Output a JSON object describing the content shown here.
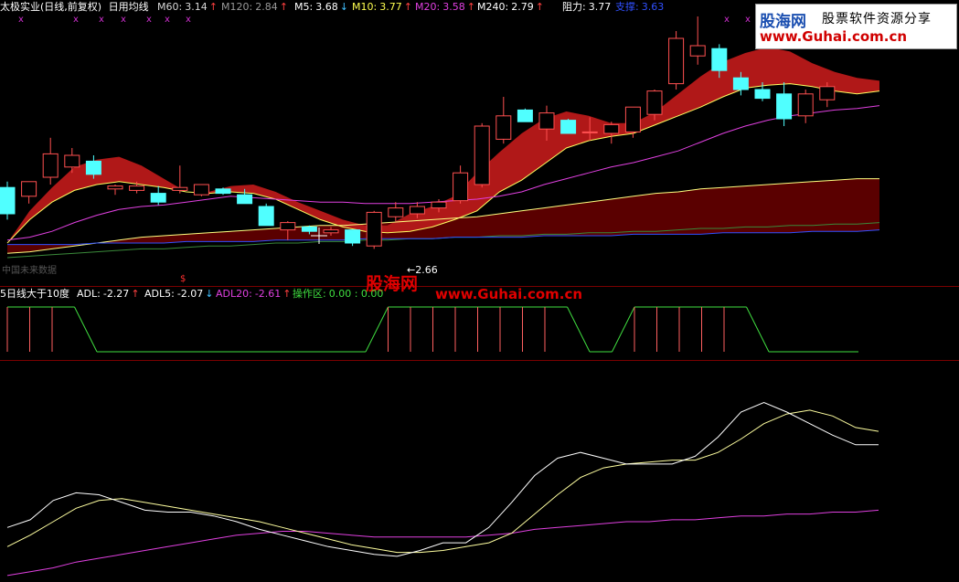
{
  "header": {
    "title": "太极实业(日线,前复权)",
    "indicator": "日用均线",
    "legend": [
      {
        "label": "M60:",
        "value": "3.14",
        "arrow": "↑",
        "color": "#d8d8d8",
        "x": 172
      },
      {
        "label": "M120:",
        "value": "2.84",
        "arrow": "↑",
        "color": "#9a9a9a",
        "x": 242
      },
      {
        "label": "M5:",
        "value": "3.68",
        "arrow": "↓",
        "color": "#ffffff",
        "x": 322
      },
      {
        "label": "M10:",
        "value": "3.77",
        "arrow": "↑",
        "color": "#ffff50",
        "x": 385
      },
      {
        "label": "M20:",
        "value": "3.58",
        "arrow": "↑",
        "color": "#e040e0",
        "x": 454
      },
      {
        "label": "M240:",
        "value": "2.79",
        "arrow": "↑",
        "color": "#ffffff",
        "x": 522
      },
      {
        "label": "阻力:",
        "value": "3.77",
        "arrow": "",
        "color": "#ffffff",
        "x": 615
      },
      {
        "label": "支撑:",
        "value": "3.63",
        "arrow": "",
        "color": "#3050ff",
        "x": 673
      }
    ]
  },
  "price_panel": {
    "low_marker": "←2.66",
    "bottom_note": "中国未来数据",
    "dollar_sign": "$",
    "watermark_text": "股海网",
    "watermark_url": "www.Guhai.com.cn"
  },
  "adl_panel": {
    "legend": [
      {
        "label": "5日线大于10度",
        "value": "",
        "arrow": "",
        "color": "#ffffff",
        "x": 0
      },
      {
        "label": "ADL:",
        "value": "-2.27",
        "arrow": "↑",
        "color": "#ffffff",
        "x": 84
      },
      {
        "label": "ADL5:",
        "value": "-2.07",
        "arrow": "↓",
        "color": "#ffffff",
        "x": 158
      },
      {
        "label": "ADL20:",
        "value": "-2.61",
        "arrow": "↑",
        "color": "#e040e0",
        "x": 236
      },
      {
        "label": "操作区:",
        "value": "0.00 : 0.00",
        "arrow": "",
        "color": "#40e040",
        "x": 320
      }
    ]
  },
  "logo": {
    "brand": "股海网",
    "slogan": "股票软件资源分享",
    "url": "www.Guhai.com.cn"
  },
  "colors": {
    "up": "#ff5050",
    "down": "#50ffff",
    "band": "#b01818",
    "band_dark": "#5a0000",
    "m60": "#ffff80",
    "m20": "#e040e0",
    "support": "#3050ff",
    "zone_line": "#40e040"
  },
  "chart_data": {
    "type": "candlestick",
    "ylim": [
      2.55,
      4.25
    ],
    "candles": [
      {
        "o": 3.08,
        "h": 3.12,
        "l": 2.86,
        "c": 2.9
      },
      {
        "o": 3.02,
        "h": 3.06,
        "l": 2.97,
        "c": 3.12
      },
      {
        "o": 3.15,
        "h": 3.42,
        "l": 3.1,
        "c": 3.31
      },
      {
        "o": 3.22,
        "h": 3.35,
        "l": 3.18,
        "c": 3.3
      },
      {
        "o": 3.26,
        "h": 3.3,
        "l": 3.14,
        "c": 3.17
      },
      {
        "o": 3.07,
        "h": 3.1,
        "l": 3.03,
        "c": 3.09
      },
      {
        "o": 3.06,
        "h": 3.12,
        "l": 3.04,
        "c": 3.09
      },
      {
        "o": 3.04,
        "h": 3.09,
        "l": 2.96,
        "c": 2.98
      },
      {
        "o": 3.06,
        "h": 3.23,
        "l": 3.04,
        "c": 3.08
      },
      {
        "o": 3.03,
        "h": 3.1,
        "l": 3.02,
        "c": 3.1
      },
      {
        "o": 3.07,
        "h": 3.08,
        "l": 3.03,
        "c": 3.04
      },
      {
        "o": 3.03,
        "h": 3.07,
        "l": 2.97,
        "c": 2.97
      },
      {
        "o": 2.95,
        "h": 2.97,
        "l": 2.82,
        "c": 2.82
      },
      {
        "o": 2.79,
        "h": 2.85,
        "l": 2.72,
        "c": 2.84
      },
      {
        "o": 2.81,
        "h": 2.82,
        "l": 2.76,
        "c": 2.78
      },
      {
        "o": 2.77,
        "h": 2.81,
        "l": 2.75,
        "c": 2.79
      },
      {
        "o": 2.79,
        "h": 2.79,
        "l": 2.68,
        "c": 2.7
      },
      {
        "o": 2.68,
        "h": 2.92,
        "l": 2.66,
        "c": 2.91
      },
      {
        "o": 2.88,
        "h": 2.98,
        "l": 2.85,
        "c": 2.94
      },
      {
        "o": 2.9,
        "h": 2.98,
        "l": 2.87,
        "c": 2.95
      },
      {
        "o": 2.94,
        "h": 3.0,
        "l": 2.91,
        "c": 2.98
      },
      {
        "o": 2.99,
        "h": 3.23,
        "l": 2.97,
        "c": 3.18
      },
      {
        "o": 3.1,
        "h": 3.52,
        "l": 3.08,
        "c": 3.5
      },
      {
        "o": 3.41,
        "h": 3.7,
        "l": 3.38,
        "c": 3.57
      },
      {
        "o": 3.61,
        "h": 3.62,
        "l": 3.53,
        "c": 3.53
      },
      {
        "o": 3.48,
        "h": 3.64,
        "l": 3.4,
        "c": 3.59
      },
      {
        "o": 3.54,
        "h": 3.55,
        "l": 3.45,
        "c": 3.45
      },
      {
        "o": 3.46,
        "h": 3.56,
        "l": 3.4,
        "c": 3.46
      },
      {
        "o": 3.45,
        "h": 3.53,
        "l": 3.38,
        "c": 3.51
      },
      {
        "o": 3.46,
        "h": 3.63,
        "l": 3.42,
        "c": 3.63
      },
      {
        "o": 3.58,
        "h": 3.75,
        "l": 3.54,
        "c": 3.74
      },
      {
        "o": 3.79,
        "h": 4.15,
        "l": 3.75,
        "c": 4.1
      },
      {
        "o": 3.98,
        "h": 4.25,
        "l": 3.92,
        "c": 4.05
      },
      {
        "o": 4.03,
        "h": 4.06,
        "l": 3.83,
        "c": 3.88
      },
      {
        "o": 3.83,
        "h": 3.87,
        "l": 3.71,
        "c": 3.75
      },
      {
        "o": 3.75,
        "h": 3.8,
        "l": 3.67,
        "c": 3.69
      },
      {
        "o": 3.72,
        "h": 3.8,
        "l": 3.5,
        "c": 3.55
      },
      {
        "o": 3.57,
        "h": 3.75,
        "l": 3.52,
        "c": 3.72
      },
      {
        "o": 3.68,
        "h": 3.8,
        "l": 3.63,
        "c": 3.77
      }
    ],
    "band_upper": [
      2.7,
      2.92,
      3.08,
      3.22,
      3.27,
      3.29,
      3.23,
      3.14,
      3.05,
      3.05,
      3.09,
      3.1,
      3.05,
      2.98,
      2.92,
      2.86,
      2.82,
      2.82,
      2.9,
      2.95,
      3.02,
      3.18,
      3.32,
      3.45,
      3.55,
      3.6,
      3.57,
      3.52,
      3.52,
      3.6,
      3.72,
      3.84,
      3.94,
      4.0,
      4.04,
      4.01,
      3.93,
      3.87,
      3.83,
      3.81
    ],
    "m5": [
      2.7,
      2.86,
      2.98,
      3.06,
      3.1,
      3.12,
      3.1,
      3.08,
      3.05,
      3.04,
      3.05,
      3.04,
      3.0,
      2.93,
      2.86,
      2.81,
      2.78,
      2.77,
      2.78,
      2.81,
      2.86,
      2.92,
      3.05,
      3.13,
      3.24,
      3.35,
      3.4,
      3.43,
      3.45,
      3.51,
      3.57,
      3.63,
      3.7,
      3.76,
      3.78,
      3.79,
      3.77,
      3.74,
      3.72,
      3.74
    ],
    "m20": [
      2.72,
      2.74,
      2.78,
      2.84,
      2.89,
      2.93,
      2.95,
      2.96,
      2.98,
      3.0,
      3.02,
      3.01,
      3.0,
      2.99,
      2.98,
      2.98,
      2.97,
      2.97,
      2.97,
      2.98,
      2.99,
      3.0,
      3.02,
      3.05,
      3.1,
      3.14,
      3.18,
      3.22,
      3.25,
      3.29,
      3.33,
      3.39,
      3.45,
      3.5,
      3.54,
      3.57,
      3.59,
      3.61,
      3.62,
      3.64
    ],
    "m60": [
      2.63,
      2.64,
      2.66,
      2.68,
      2.7,
      2.72,
      2.74,
      2.75,
      2.76,
      2.77,
      2.78,
      2.79,
      2.8,
      2.81,
      2.82,
      2.82,
      2.83,
      2.84,
      2.85,
      2.86,
      2.87,
      2.88,
      2.9,
      2.92,
      2.94,
      2.96,
      2.98,
      3.0,
      3.02,
      3.04,
      3.05,
      3.07,
      3.08,
      3.09,
      3.1,
      3.11,
      3.12,
      3.13,
      3.14,
      3.14
    ],
    "m120": [
      2.6,
      2.61,
      2.62,
      2.63,
      2.64,
      2.65,
      2.66,
      2.66,
      2.67,
      2.68,
      2.68,
      2.69,
      2.7,
      2.7,
      2.71,
      2.71,
      2.72,
      2.72,
      2.73,
      2.73,
      2.74,
      2.74,
      2.75,
      2.75,
      2.76,
      2.76,
      2.77,
      2.77,
      2.78,
      2.78,
      2.79,
      2.8,
      2.8,
      2.81,
      2.81,
      2.82,
      2.82,
      2.83,
      2.83,
      2.84
    ],
    "m240": [
      2.69,
      2.69,
      2.69,
      2.69,
      2.7,
      2.7,
      2.7,
      2.7,
      2.71,
      2.71,
      2.71,
      2.71,
      2.72,
      2.72,
      2.72,
      2.72,
      2.73,
      2.73,
      2.73,
      2.73,
      2.74,
      2.74,
      2.74,
      2.74,
      2.75,
      2.75,
      2.75,
      2.75,
      2.76,
      2.76,
      2.76,
      2.76,
      2.77,
      2.77,
      2.77,
      2.77,
      2.78,
      2.78,
      2.78,
      2.79
    ],
    "zone_flags": [
      1,
      1,
      1,
      1,
      0,
      0,
      0,
      0,
      0,
      0,
      0,
      0,
      0,
      0,
      0,
      0,
      0,
      1,
      1,
      1,
      1,
      1,
      1,
      1,
      1,
      1,
      0,
      0,
      1,
      1,
      1,
      1,
      1,
      1,
      0,
      0,
      0,
      0,
      0
    ],
    "adl": [
      -2.7,
      -2.66,
      -2.56,
      -2.52,
      -2.53,
      -2.57,
      -2.61,
      -2.62,
      -2.62,
      -2.64,
      -2.67,
      -2.71,
      -2.74,
      -2.77,
      -2.8,
      -2.82,
      -2.84,
      -2.85,
      -2.82,
      -2.78,
      -2.78,
      -2.7,
      -2.57,
      -2.43,
      -2.34,
      -2.31,
      -2.34,
      -2.37,
      -2.37,
      -2.37,
      -2.33,
      -2.23,
      -2.1,
      -2.05,
      -2.1,
      -2.16,
      -2.22,
      -2.27,
      -2.27
    ],
    "adl5": [
      -2.8,
      -2.74,
      -2.67,
      -2.6,
      -2.56,
      -2.55,
      -2.57,
      -2.59,
      -2.61,
      -2.63,
      -2.65,
      -2.67,
      -2.7,
      -2.73,
      -2.76,
      -2.79,
      -2.81,
      -2.83,
      -2.83,
      -2.82,
      -2.8,
      -2.78,
      -2.73,
      -2.63,
      -2.53,
      -2.44,
      -2.39,
      -2.37,
      -2.36,
      -2.35,
      -2.35,
      -2.31,
      -2.24,
      -2.16,
      -2.11,
      -2.09,
      -2.12,
      -2.18,
      -2.2
    ],
    "adl20": [
      -2.95,
      -2.93,
      -2.91,
      -2.88,
      -2.86,
      -2.84,
      -2.82,
      -2.8,
      -2.78,
      -2.76,
      -2.74,
      -2.73,
      -2.72,
      -2.72,
      -2.73,
      -2.74,
      -2.75,
      -2.75,
      -2.75,
      -2.75,
      -2.75,
      -2.74,
      -2.73,
      -2.71,
      -2.7,
      -2.69,
      -2.68,
      -2.67,
      -2.67,
      -2.66,
      -2.66,
      -2.65,
      -2.64,
      -2.64,
      -2.63,
      -2.63,
      -2.62,
      -2.62,
      -2.61
    ]
  }
}
